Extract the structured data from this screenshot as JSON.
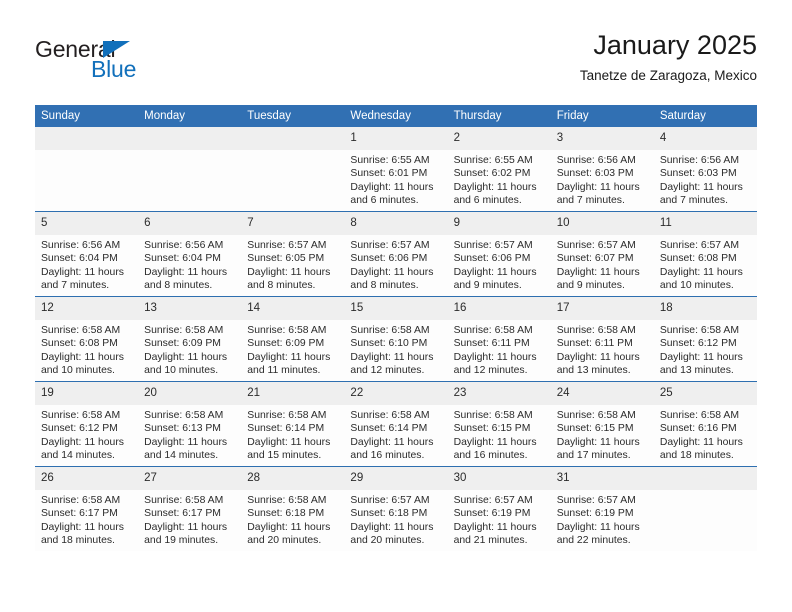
{
  "brand": {
    "word_one": "General",
    "word_two": "Blue",
    "triangle_icon": "triangle-icon",
    "accent_color": "#1270bb"
  },
  "header": {
    "title": "January 2025",
    "subtitle": "Tanetze de Zaragoza, Mexico"
  },
  "theme": {
    "header_blue": "#3170b3",
    "row_rule": "#2e6fb0",
    "daynum_band": "#efefef"
  },
  "calendar": {
    "weekday_headers": [
      "Sunday",
      "Monday",
      "Tuesday",
      "Wednesday",
      "Thursday",
      "Friday",
      "Saturday"
    ],
    "weeks": [
      [
        {
          "day": "",
          "empty": true
        },
        {
          "day": "",
          "empty": true
        },
        {
          "day": "",
          "empty": true
        },
        {
          "day": "1",
          "sunrise": "Sunrise: 6:55 AM",
          "sunset": "Sunset: 6:01 PM",
          "daylight": "Daylight: 11 hours and 6 minutes."
        },
        {
          "day": "2",
          "sunrise": "Sunrise: 6:55 AM",
          "sunset": "Sunset: 6:02 PM",
          "daylight": "Daylight: 11 hours and 6 minutes."
        },
        {
          "day": "3",
          "sunrise": "Sunrise: 6:56 AM",
          "sunset": "Sunset: 6:03 PM",
          "daylight": "Daylight: 11 hours and 7 minutes."
        },
        {
          "day": "4",
          "sunrise": "Sunrise: 6:56 AM",
          "sunset": "Sunset: 6:03 PM",
          "daylight": "Daylight: 11 hours and 7 minutes."
        }
      ],
      [
        {
          "day": "5",
          "sunrise": "Sunrise: 6:56 AM",
          "sunset": "Sunset: 6:04 PM",
          "daylight": "Daylight: 11 hours and 7 minutes."
        },
        {
          "day": "6",
          "sunrise": "Sunrise: 6:56 AM",
          "sunset": "Sunset: 6:04 PM",
          "daylight": "Daylight: 11 hours and 8 minutes."
        },
        {
          "day": "7",
          "sunrise": "Sunrise: 6:57 AM",
          "sunset": "Sunset: 6:05 PM",
          "daylight": "Daylight: 11 hours and 8 minutes."
        },
        {
          "day": "8",
          "sunrise": "Sunrise: 6:57 AM",
          "sunset": "Sunset: 6:06 PM",
          "daylight": "Daylight: 11 hours and 8 minutes."
        },
        {
          "day": "9",
          "sunrise": "Sunrise: 6:57 AM",
          "sunset": "Sunset: 6:06 PM",
          "daylight": "Daylight: 11 hours and 9 minutes."
        },
        {
          "day": "10",
          "sunrise": "Sunrise: 6:57 AM",
          "sunset": "Sunset: 6:07 PM",
          "daylight": "Daylight: 11 hours and 9 minutes."
        },
        {
          "day": "11",
          "sunrise": "Sunrise: 6:57 AM",
          "sunset": "Sunset: 6:08 PM",
          "daylight": "Daylight: 11 hours and 10 minutes."
        }
      ],
      [
        {
          "day": "12",
          "sunrise": "Sunrise: 6:58 AM",
          "sunset": "Sunset: 6:08 PM",
          "daylight": "Daylight: 11 hours and 10 minutes."
        },
        {
          "day": "13",
          "sunrise": "Sunrise: 6:58 AM",
          "sunset": "Sunset: 6:09 PM",
          "daylight": "Daylight: 11 hours and 10 minutes."
        },
        {
          "day": "14",
          "sunrise": "Sunrise: 6:58 AM",
          "sunset": "Sunset: 6:09 PM",
          "daylight": "Daylight: 11 hours and 11 minutes."
        },
        {
          "day": "15",
          "sunrise": "Sunrise: 6:58 AM",
          "sunset": "Sunset: 6:10 PM",
          "daylight": "Daylight: 11 hours and 12 minutes."
        },
        {
          "day": "16",
          "sunrise": "Sunrise: 6:58 AM",
          "sunset": "Sunset: 6:11 PM",
          "daylight": "Daylight: 11 hours and 12 minutes."
        },
        {
          "day": "17",
          "sunrise": "Sunrise: 6:58 AM",
          "sunset": "Sunset: 6:11 PM",
          "daylight": "Daylight: 11 hours and 13 minutes."
        },
        {
          "day": "18",
          "sunrise": "Sunrise: 6:58 AM",
          "sunset": "Sunset: 6:12 PM",
          "daylight": "Daylight: 11 hours and 13 minutes."
        }
      ],
      [
        {
          "day": "19",
          "sunrise": "Sunrise: 6:58 AM",
          "sunset": "Sunset: 6:12 PM",
          "daylight": "Daylight: 11 hours and 14 minutes."
        },
        {
          "day": "20",
          "sunrise": "Sunrise: 6:58 AM",
          "sunset": "Sunset: 6:13 PM",
          "daylight": "Daylight: 11 hours and 14 minutes."
        },
        {
          "day": "21",
          "sunrise": "Sunrise: 6:58 AM",
          "sunset": "Sunset: 6:14 PM",
          "daylight": "Daylight: 11 hours and 15 minutes."
        },
        {
          "day": "22",
          "sunrise": "Sunrise: 6:58 AM",
          "sunset": "Sunset: 6:14 PM",
          "daylight": "Daylight: 11 hours and 16 minutes."
        },
        {
          "day": "23",
          "sunrise": "Sunrise: 6:58 AM",
          "sunset": "Sunset: 6:15 PM",
          "daylight": "Daylight: 11 hours and 16 minutes."
        },
        {
          "day": "24",
          "sunrise": "Sunrise: 6:58 AM",
          "sunset": "Sunset: 6:15 PM",
          "daylight": "Daylight: 11 hours and 17 minutes."
        },
        {
          "day": "25",
          "sunrise": "Sunrise: 6:58 AM",
          "sunset": "Sunset: 6:16 PM",
          "daylight": "Daylight: 11 hours and 18 minutes."
        }
      ],
      [
        {
          "day": "26",
          "sunrise": "Sunrise: 6:58 AM",
          "sunset": "Sunset: 6:17 PM",
          "daylight": "Daylight: 11 hours and 18 minutes."
        },
        {
          "day": "27",
          "sunrise": "Sunrise: 6:58 AM",
          "sunset": "Sunset: 6:17 PM",
          "daylight": "Daylight: 11 hours and 19 minutes."
        },
        {
          "day": "28",
          "sunrise": "Sunrise: 6:58 AM",
          "sunset": "Sunset: 6:18 PM",
          "daylight": "Daylight: 11 hours and 20 minutes."
        },
        {
          "day": "29",
          "sunrise": "Sunrise: 6:57 AM",
          "sunset": "Sunset: 6:18 PM",
          "daylight": "Daylight: 11 hours and 20 minutes."
        },
        {
          "day": "30",
          "sunrise": "Sunrise: 6:57 AM",
          "sunset": "Sunset: 6:19 PM",
          "daylight": "Daylight: 11 hours and 21 minutes."
        },
        {
          "day": "31",
          "sunrise": "Sunrise: 6:57 AM",
          "sunset": "Sunset: 6:19 PM",
          "daylight": "Daylight: 11 hours and 22 minutes."
        },
        {
          "day": "",
          "empty": true
        }
      ]
    ]
  }
}
